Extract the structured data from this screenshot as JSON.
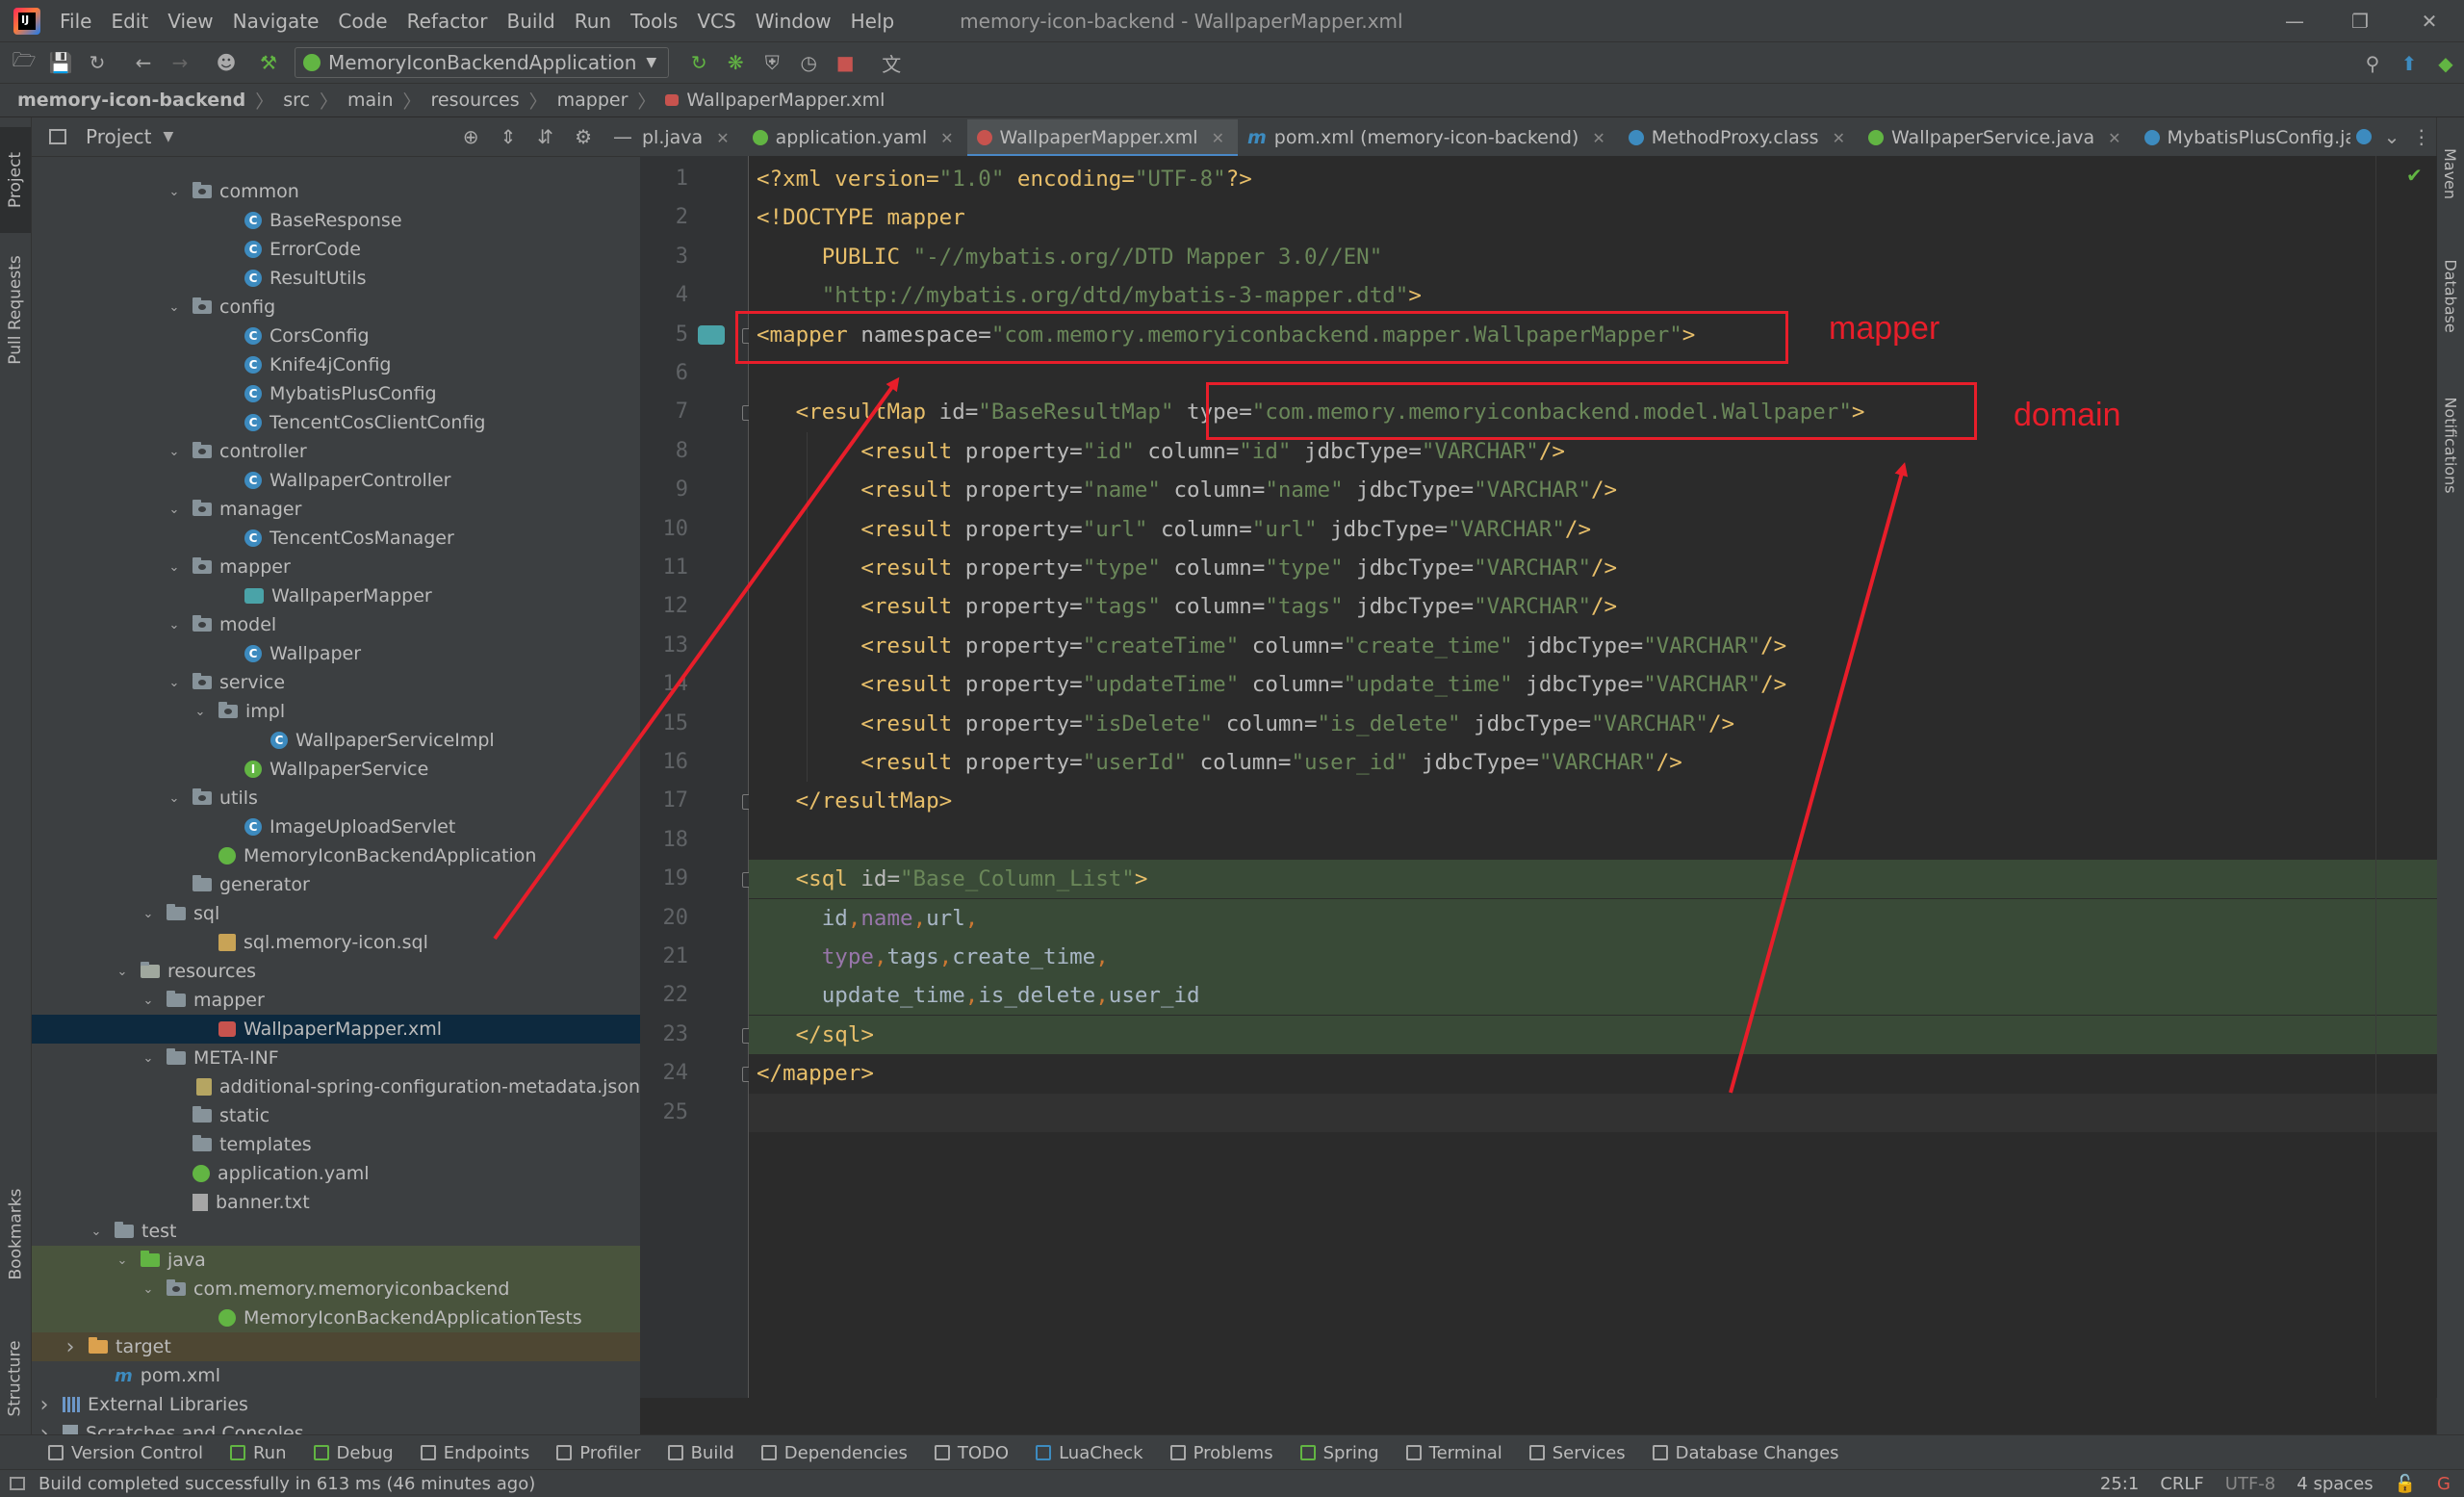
{
  "menubar": {
    "items": [
      "File",
      "Edit",
      "View",
      "Navigate",
      "Code",
      "Refactor",
      "Build",
      "Run",
      "Tools",
      "VCS",
      "Window",
      "Help"
    ],
    "window_title": "memory-icon-backend - WallpaperMapper.xml"
  },
  "toolbar": {
    "run_config": "MemoryIconBackendApplication"
  },
  "breadcrumb": [
    "memory-icon-backend",
    "src",
    "main",
    "resources",
    "mapper",
    "WallpaperMapper.xml"
  ],
  "left_stripe": {
    "project": "Project",
    "pull_requests": "Pull Requests",
    "bookmarks": "Bookmarks",
    "structure": "Structure"
  },
  "right_stripe": {
    "maven": "Maven",
    "database": "Database",
    "notifications": "Notifications"
  },
  "project_panel": {
    "title": "Project"
  },
  "tree": [
    {
      "label": "common",
      "kind": "pkg",
      "depth": 5,
      "expanded": true
    },
    {
      "label": "BaseResponse",
      "kind": "class",
      "depth": 7
    },
    {
      "label": "ErrorCode",
      "kind": "class",
      "depth": 7
    },
    {
      "label": "ResultUtils",
      "kind": "class",
      "depth": 7
    },
    {
      "label": "config",
      "kind": "pkg",
      "depth": 5,
      "expanded": true
    },
    {
      "label": "CorsConfig",
      "kind": "class",
      "depth": 7
    },
    {
      "label": "Knife4jConfig",
      "kind": "class",
      "depth": 7
    },
    {
      "label": "MybatisPlusConfig",
      "kind": "class",
      "depth": 7
    },
    {
      "label": "TencentCosClientConfig",
      "kind": "class",
      "depth": 7
    },
    {
      "label": "controller",
      "kind": "pkg",
      "depth": 5,
      "expanded": true
    },
    {
      "label": "WallpaperController",
      "kind": "class",
      "depth": 7
    },
    {
      "label": "manager",
      "kind": "pkg",
      "depth": 5,
      "expanded": true
    },
    {
      "label": "TencentCosManager",
      "kind": "class",
      "depth": 7
    },
    {
      "label": "mapper",
      "kind": "pkg",
      "depth": 5,
      "expanded": true
    },
    {
      "label": "WallpaperMapper",
      "kind": "mapper",
      "depth": 7
    },
    {
      "label": "model",
      "kind": "pkg",
      "depth": 5,
      "expanded": true
    },
    {
      "label": "Wallpaper",
      "kind": "class",
      "depth": 7
    },
    {
      "label": "service",
      "kind": "pkg",
      "depth": 5,
      "expanded": true
    },
    {
      "label": "impl",
      "kind": "pkg",
      "depth": 6,
      "expanded": true
    },
    {
      "label": "WallpaperServiceImpl",
      "kind": "class",
      "depth": 8
    },
    {
      "label": "WallpaperService",
      "kind": "iface",
      "depth": 7
    },
    {
      "label": "utils",
      "kind": "pkg",
      "depth": 5,
      "expanded": true
    },
    {
      "label": "ImageUploadServlet",
      "kind": "class",
      "depth": 7
    },
    {
      "label": "MemoryIconBackendApplication",
      "kind": "spring",
      "depth": 6
    },
    {
      "label": "generator",
      "kind": "folder",
      "depth": 5
    },
    {
      "label": "sql",
      "kind": "folder",
      "depth": 4,
      "expanded": true
    },
    {
      "label": "sql.memory-icon.sql",
      "kind": "sqlfile",
      "depth": 6
    },
    {
      "label": "resources",
      "kind": "res",
      "depth": 3,
      "expanded": true
    },
    {
      "label": "mapper",
      "kind": "folder",
      "depth": 4,
      "expanded": true
    },
    {
      "label": "WallpaperMapper.xml",
      "kind": "xml",
      "depth": 6,
      "selected": true
    },
    {
      "label": "META-INF",
      "kind": "folder",
      "depth": 4,
      "expanded": true
    },
    {
      "label": "additional-spring-configuration-metadata.json",
      "kind": "json",
      "depth": 6
    },
    {
      "label": "static",
      "kind": "folder",
      "depth": 5
    },
    {
      "label": "templates",
      "kind": "folder",
      "depth": 5
    },
    {
      "label": "application.yaml",
      "kind": "spring",
      "depth": 5
    },
    {
      "label": "banner.txt",
      "kind": "file",
      "depth": 5
    },
    {
      "label": "test",
      "kind": "folder",
      "depth": 2,
      "expanded": true
    },
    {
      "label": "java",
      "kind": "src",
      "depth": 3,
      "expanded": true,
      "bg": "test"
    },
    {
      "label": "com.memory.memoryiconbackend",
      "kind": "pkg",
      "depth": 4,
      "expanded": true,
      "bg": "test"
    },
    {
      "label": "MemoryIconBackendApplicationTests",
      "kind": "spring",
      "depth": 6,
      "bg": "test"
    },
    {
      "label": "target",
      "kind": "target",
      "depth": 1,
      "collapsed": true,
      "bg": "target"
    },
    {
      "label": "pom.xml",
      "kind": "maven",
      "depth": 2
    },
    {
      "label": "External Libraries",
      "kind": "lib",
      "depth": 0,
      "collapsed": true
    },
    {
      "label": "Scratches and Consoles",
      "kind": "scratch",
      "depth": 0,
      "collapsed": true
    }
  ],
  "editor_tabs": [
    {
      "label": "pl.java",
      "color": "#3d8bbf",
      "partial": true
    },
    {
      "label": "application.yaml",
      "color": "#62b543"
    },
    {
      "label": "WallpaperMapper.xml",
      "color": "#c7534e",
      "active": true
    },
    {
      "label": "pom.xml (memory-icon-backend)",
      "color": "#3d8bbf",
      "maven": true
    },
    {
      "label": "MethodProxy.class",
      "color": "#3d8bbf"
    },
    {
      "label": "WallpaperService.java",
      "color": "#62b543"
    },
    {
      "label": "MybatisPlusConfig.java",
      "color": "#3d8bbf"
    }
  ],
  "code_lines": [
    "1",
    "2",
    "3",
    "4",
    "5",
    "6",
    "7",
    "8",
    "9",
    "10",
    "11",
    "12",
    "13",
    "14",
    "15",
    "16",
    "17",
    "18",
    "19",
    "20",
    "21",
    "22",
    "23",
    "24",
    "25"
  ],
  "code": {
    "l1": [
      "<?xml version=",
      "\"1.0\"",
      " encoding=",
      "\"UTF-8\"",
      "?>"
    ],
    "l2": [
      "<!DOCTYPE mapper"
    ],
    "l3": [
      "PUBLIC ",
      "\"-//mybatis.org//DTD Mapper 3.0//EN\""
    ],
    "l4": [
      "\"http://mybatis.org/dtd/mybatis-3-mapper.dtd\"",
      ">"
    ],
    "l5": [
      "<mapper ",
      "namespace=",
      "\"com.memory.memoryiconbackend.mapper.WallpaperMapper\"",
      ">"
    ],
    "l7": [
      "<resultMap ",
      "id=",
      "\"BaseResultMap\"",
      " type=",
      "\"com.memory.memoryiconbackend.model.Wallpaper\"",
      ">"
    ],
    "results": [
      {
        "property": "\"id\"",
        "column": "\"id\"",
        "jdbc": "\"VARCHAR\""
      },
      {
        "property": "\"name\"",
        "column": "\"name\"",
        "jdbc": "\"VARCHAR\""
      },
      {
        "property": "\"url\"",
        "column": "\"url\"",
        "jdbc": "\"VARCHAR\""
      },
      {
        "property": "\"type\"",
        "column": "\"type\"",
        "jdbc": "\"VARCHAR\""
      },
      {
        "property": "\"tags\"",
        "column": "\"tags\"",
        "jdbc": "\"VARCHAR\""
      },
      {
        "property": "\"createTime\"",
        "column": "\"create_time\"",
        "jdbc": "\"VARCHAR\""
      },
      {
        "property": "\"updateTime\"",
        "column": "\"update_time\"",
        "jdbc": "\"VARCHAR\""
      },
      {
        "property": "\"isDelete\"",
        "column": "\"is_delete\"",
        "jdbc": "\"VARCHAR\""
      },
      {
        "property": "\"userId\"",
        "column": "\"user_id\"",
        "jdbc": "\"VARCHAR\""
      }
    ],
    "result_tokens": [
      "<result ",
      "property=",
      "column=",
      "jdbcType=",
      "/>"
    ],
    "l17": [
      "</resultMap>"
    ],
    "l19": [
      "<sql ",
      "id=",
      "\"Base_Column_List\"",
      ">"
    ],
    "l20": [
      "id",
      ",",
      "name",
      ",",
      "url",
      ","
    ],
    "l21": [
      "type",
      ",",
      "tags",
      ",",
      "create_time",
      ","
    ],
    "l22": [
      "update_time",
      ",",
      "is_delete",
      ",",
      "user_id"
    ],
    "l23": [
      "</sql>"
    ],
    "l24": [
      "</mapper>"
    ]
  },
  "annotations": {
    "mapper_label": "mapper",
    "domain_label": "domain",
    "color": "#e81e2a"
  },
  "bottom_tools": [
    "Version Control",
    "Run",
    "Debug",
    "Endpoints",
    "Profiler",
    "Build",
    "Dependencies",
    "TODO",
    "LuaCheck",
    "Problems",
    "Spring",
    "Terminal",
    "Services",
    "Database Changes"
  ],
  "status": {
    "message": "Build completed successfully in 613 ms (46 minutes ago)",
    "position": "25:1",
    "line_sep": "CRLF",
    "encoding": "UTF-8",
    "indent": "4 spaces"
  }
}
